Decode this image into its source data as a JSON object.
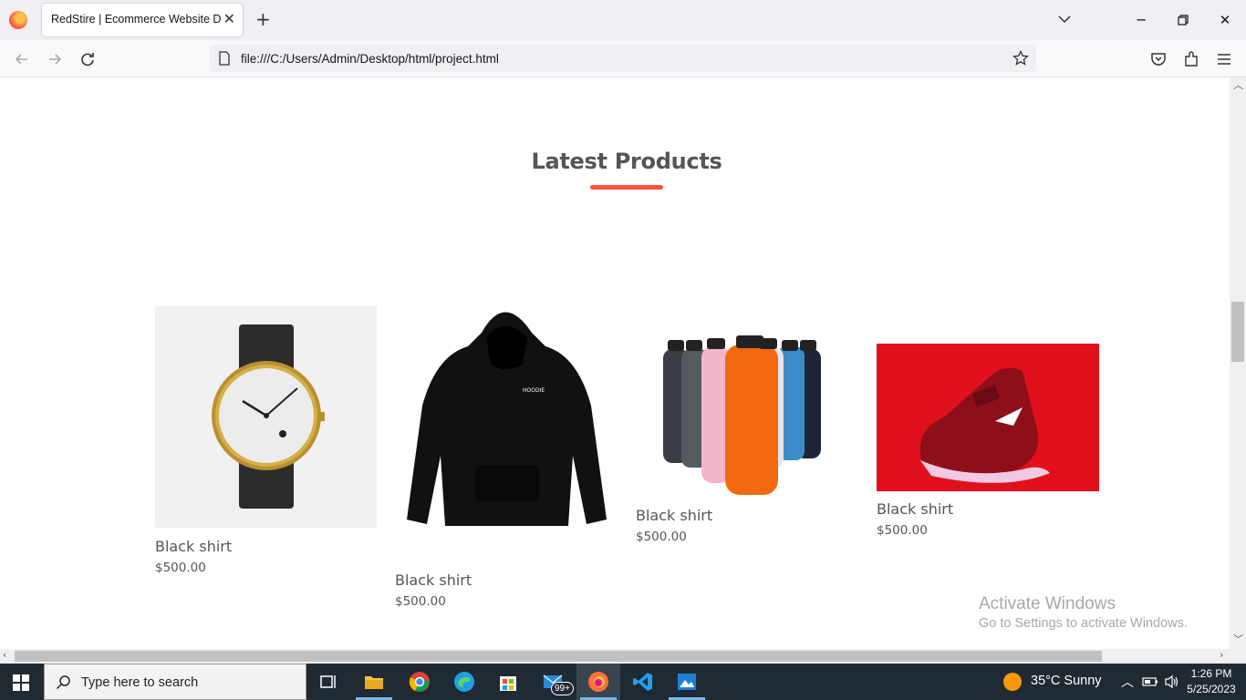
{
  "browser": {
    "tab_title": "RedStire | Ecommerce Website Design",
    "url": "file:///C:/Users/Admin/Desktop/html/project.html"
  },
  "page": {
    "section_title": "Latest Products",
    "accent_color": "#ff523b",
    "products": [
      {
        "name": "Black shirt",
        "price": "$500.00",
        "image": "watch"
      },
      {
        "name": "Black shirt",
        "price": "$500.00",
        "image": "hoodie"
      },
      {
        "name": "Black shirt",
        "price": "$500.00",
        "image": "water-bottles"
      },
      {
        "name": "Black shirt",
        "price": "$500.00",
        "image": "red-sneaker"
      }
    ]
  },
  "watermark": {
    "line1": "Activate Windows",
    "line2": "Go to Settings to activate Windows."
  },
  "taskbar": {
    "search_placeholder": "Type here to search",
    "mail_badge": "99+",
    "weather": "35°C  Sunny",
    "time": "1:26 PM",
    "date": "5/25/2023"
  }
}
